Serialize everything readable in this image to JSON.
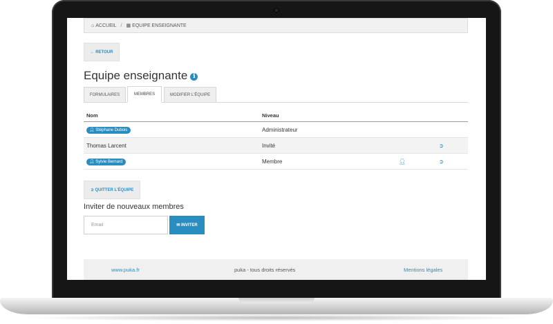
{
  "breadcrumb": {
    "home": "ACCUEIL",
    "separator": "/",
    "current": "EQUIPE ENSEIGNANTE"
  },
  "back_button": "← RETOUR",
  "page_title": "Equipe enseignante",
  "info_icon": "i",
  "tabs": [
    {
      "label": "FORMULAIRES",
      "active": false
    },
    {
      "label": "MEMBRES",
      "active": true
    },
    {
      "label": "MODIFIER L'ÉQUIPE",
      "active": false
    }
  ],
  "table": {
    "headers": {
      "name": "Nom",
      "level": "Niveau"
    },
    "rows": [
      {
        "name": "Stéphane Dubois",
        "level": "Administrateur",
        "badge": true
      },
      {
        "name": "Thomas Larcent",
        "level": "Invité",
        "badge": false
      },
      {
        "name": "Sylvie Bernard",
        "level": "Membre",
        "badge": true
      }
    ]
  },
  "quit_button": "QUITTER L'ÉQUIPE",
  "invite": {
    "heading": "Inviter de nouveaux membres",
    "placeholder": "Email",
    "button": "INVITER"
  },
  "footer": {
    "left": "www.puka.fr",
    "center": "puka - tous droits réservés",
    "right": "Mentions légales"
  },
  "colors": {
    "accent": "#2a8dc0",
    "panel": "#f1f1f1"
  },
  "icons": [
    "home-icon",
    "grid-icon",
    "arrow-left-icon",
    "info-icon",
    "user-icon",
    "sign-out-icon",
    "envelope-icon"
  ]
}
